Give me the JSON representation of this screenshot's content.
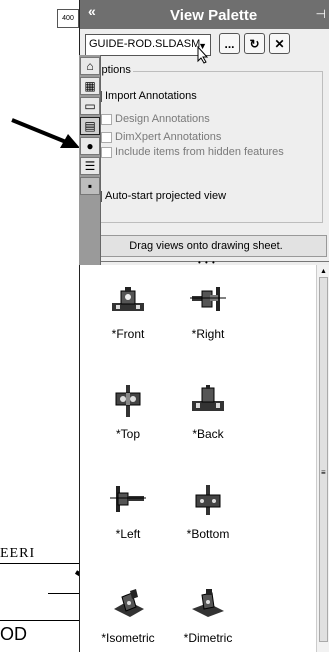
{
  "background": {
    "ruler_text": "400",
    "frag_text_1": "EERI",
    "frag_text_2": "OD"
  },
  "panel": {
    "collapse_label": "«",
    "title": "View Palette",
    "pin_label": "⊣"
  },
  "toolbar": {
    "document_select_value": "GUIDE-ROD.SLDASM",
    "browse_label": "...",
    "refresh_label": "↻",
    "clear_label": "✕"
  },
  "options": {
    "legend": "Options",
    "import_annotations": {
      "label": "Import Annotations",
      "checked": false
    },
    "design_annotations": {
      "label": "Design Annotations",
      "checked": false,
      "enabled": false
    },
    "dimxpert_annotations": {
      "label": "DimXpert Annotations",
      "checked": false,
      "enabled": false
    },
    "hidden_features": {
      "label": "Include items from hidden features",
      "checked": false,
      "enabled": false
    },
    "auto_start": {
      "label": "Auto-start projected view",
      "checked": true
    }
  },
  "drag_hint": "Drag views onto drawing sheet.",
  "views": [
    {
      "label": "*Front",
      "icon": "front-view-icon"
    },
    {
      "label": "*Right",
      "icon": "right-view-icon"
    },
    {
      "label": "*Top",
      "icon": "top-view-icon"
    },
    {
      "label": "*Back",
      "icon": "back-view-icon"
    },
    {
      "label": "*Left",
      "icon": "left-view-icon"
    },
    {
      "label": "*Bottom",
      "icon": "bottom-view-icon"
    },
    {
      "label": "*Isometric",
      "icon": "isometric-view-icon"
    },
    {
      "label": "*Dimetric",
      "icon": "dimetric-view-icon"
    }
  ],
  "side_tabs": [
    {
      "icon": "home-icon"
    },
    {
      "icon": "parts-icon"
    },
    {
      "icon": "folder-icon"
    },
    {
      "icon": "view-palette-icon",
      "selected": true
    },
    {
      "icon": "appearances-icon"
    },
    {
      "icon": "custom-properties-icon"
    },
    {
      "icon": "solidworks-forum-icon"
    }
  ]
}
